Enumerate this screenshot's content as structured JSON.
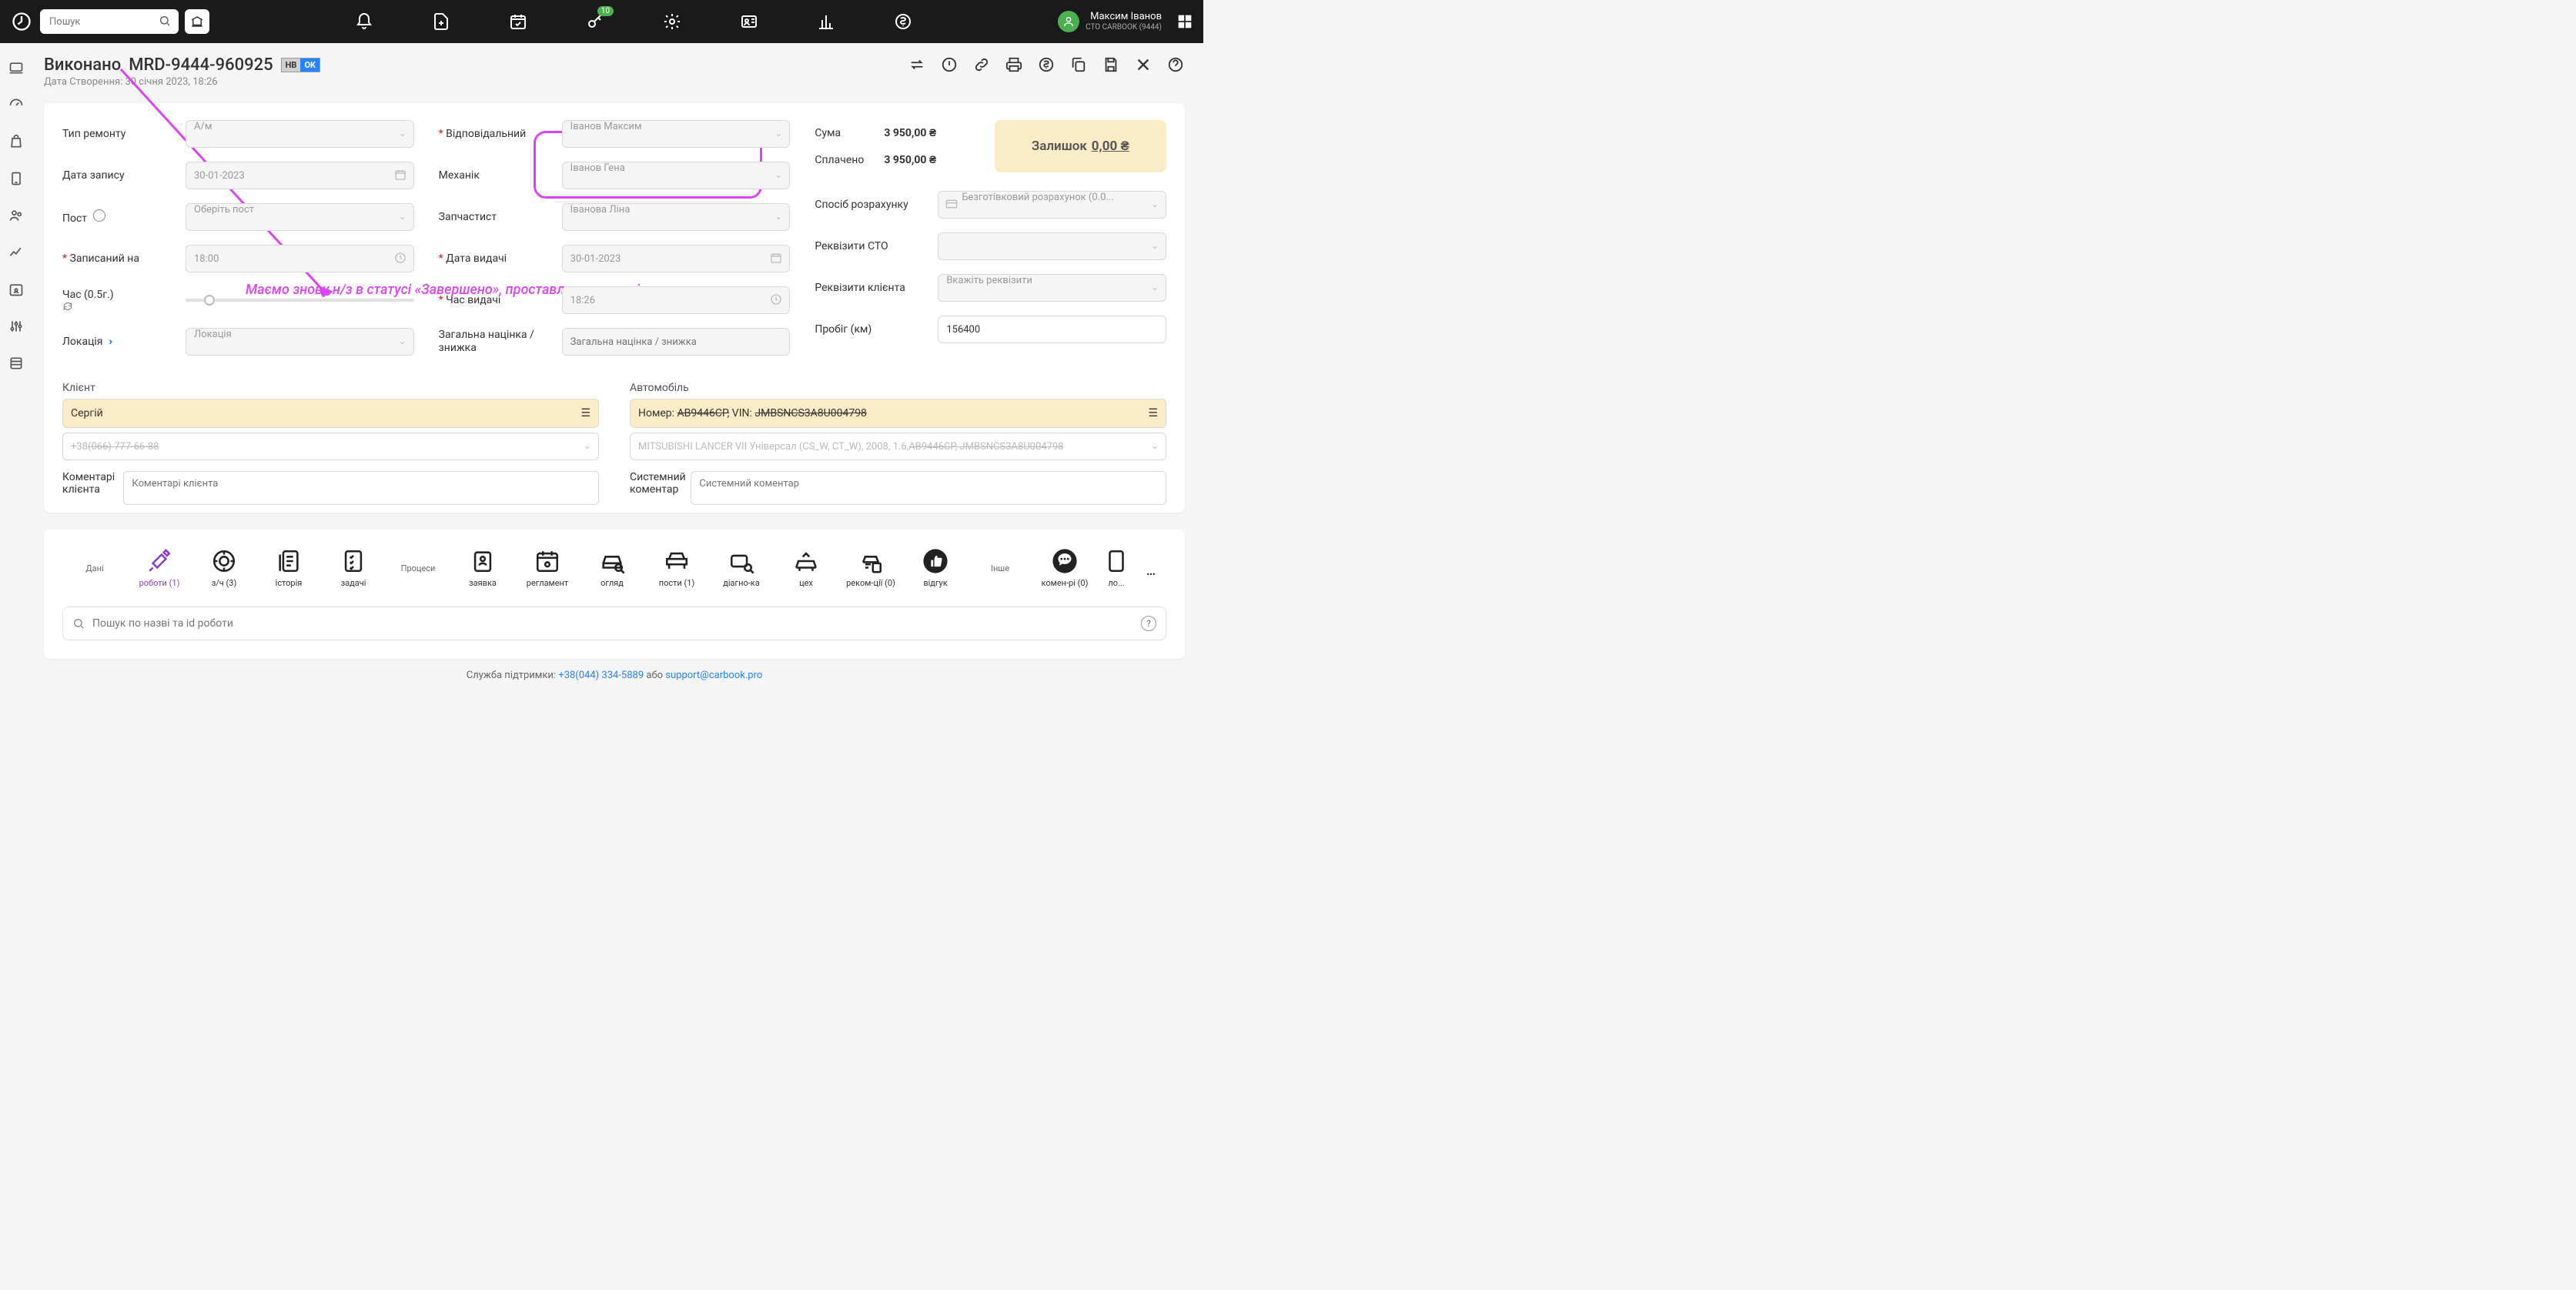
{
  "search_placeholder": "Пошук",
  "keys_badge": "10",
  "user": {
    "name": "Максим Іванов",
    "sub": "СТО CARBOOK (9444)"
  },
  "header": {
    "status": "Виконано",
    "order_no": "MRD-9444-960925",
    "tag_nv": "НВ",
    "tag_ok": "OK",
    "sub_label": "Дата Створення:",
    "sub_value": "30 січня 2023, 18:26"
  },
  "form": {
    "repair_type_lbl": "Тип ремонту",
    "repair_type_val": "А/м",
    "date_lbl": "Дата запису",
    "date_val": "30-01-2023",
    "post_lbl": "Пост",
    "post_val": "Оберіть пост",
    "scheduled_lbl": "Записаний на",
    "scheduled_val": "18:00",
    "time_lbl": "Час (0.5г.)",
    "location_lbl": "Локація",
    "location_val": "Локація",
    "responsible_lbl": "Відповідальний",
    "responsible_val": "Іванов Максим",
    "mechanic_lbl": "Механік",
    "mechanic_val": "Іванов Гена",
    "parts_lbl": "Запчастист",
    "parts_val": "Іванова Ліна",
    "issue_date_lbl": "Дата видачі",
    "issue_date_val": "30-01-2023",
    "issue_time_lbl": "Час видачі",
    "issue_time_val": "18:26",
    "discount_lbl": "Загальна націнка / знижка",
    "discount_ph": "Загальна націнка / знижка",
    "sum_lbl": "Сума",
    "sum_val": "3 950,00 ₴",
    "paid_lbl": "Сплачено",
    "paid_val": "3 950,00 ₴",
    "balance_lbl": "Залишок",
    "balance_val": "0,00 ₴",
    "paymethod_lbl": "Спосіб розрахунку",
    "paymethod_val": "Безготівковий розрахунок (0.0...",
    "sto_req_lbl": "Реквізити СТО",
    "client_req_lbl": "Реквізити клієнта",
    "client_req_ph": "Вкажіть реквізити",
    "mileage_lbl": "Пробіг (км)",
    "mileage_val": "156400"
  },
  "client": {
    "heading": "Клієнт",
    "name": "Сергій",
    "phone_prefix": "+38",
    "phone_rest": "(066) 777-66-88"
  },
  "car": {
    "heading": "Автомобіль",
    "line1_prefix": "Номер: ",
    "line1_plate": "АВ9446СР,",
    "line1_vin_lbl": "  VIN: ",
    "line1_vin": "JMBSNCS3A8U004798",
    "line2_model": "MITSUBISHI LANCER VII Універсал (CS_W, CT_W), 2008, 1.6, ",
    "line2_strike": "АВ9446СР, JMBSNCS3A8U004798"
  },
  "comments": {
    "client_lbl": "Коментарі клієнта",
    "client_ph": "Коментарі клієнта",
    "sys_lbl": "Системний коментар",
    "sys_ph": "Системний коментар"
  },
  "tabs": {
    "data": "Дані",
    "works": "роботи (1)",
    "parts": "з/ч (3)",
    "history": "історія",
    "tasks": "задачі",
    "processes": "Процеси",
    "request": "заявка",
    "schedule": "регламент",
    "inspect": "огляд",
    "posts": "пости (1)",
    "diag": "діагно-ка",
    "shop": "цех",
    "recom": "реком-ції (0)",
    "review": "відгук",
    "other": "Інше",
    "coms": "комен-рі (0)",
    "logs": "ло..."
  },
  "tab_search_ph": "Пошук по назві та id роботи",
  "footer": {
    "pre": "Служба підтримки: ",
    "phone": "+38(044) 334-5889",
    "mid": " або ",
    "mail": "support@carbook.pro"
  },
  "annotation": "Маємо знову н/з в статусі «Завершено», проставлених механіка та запчастита."
}
